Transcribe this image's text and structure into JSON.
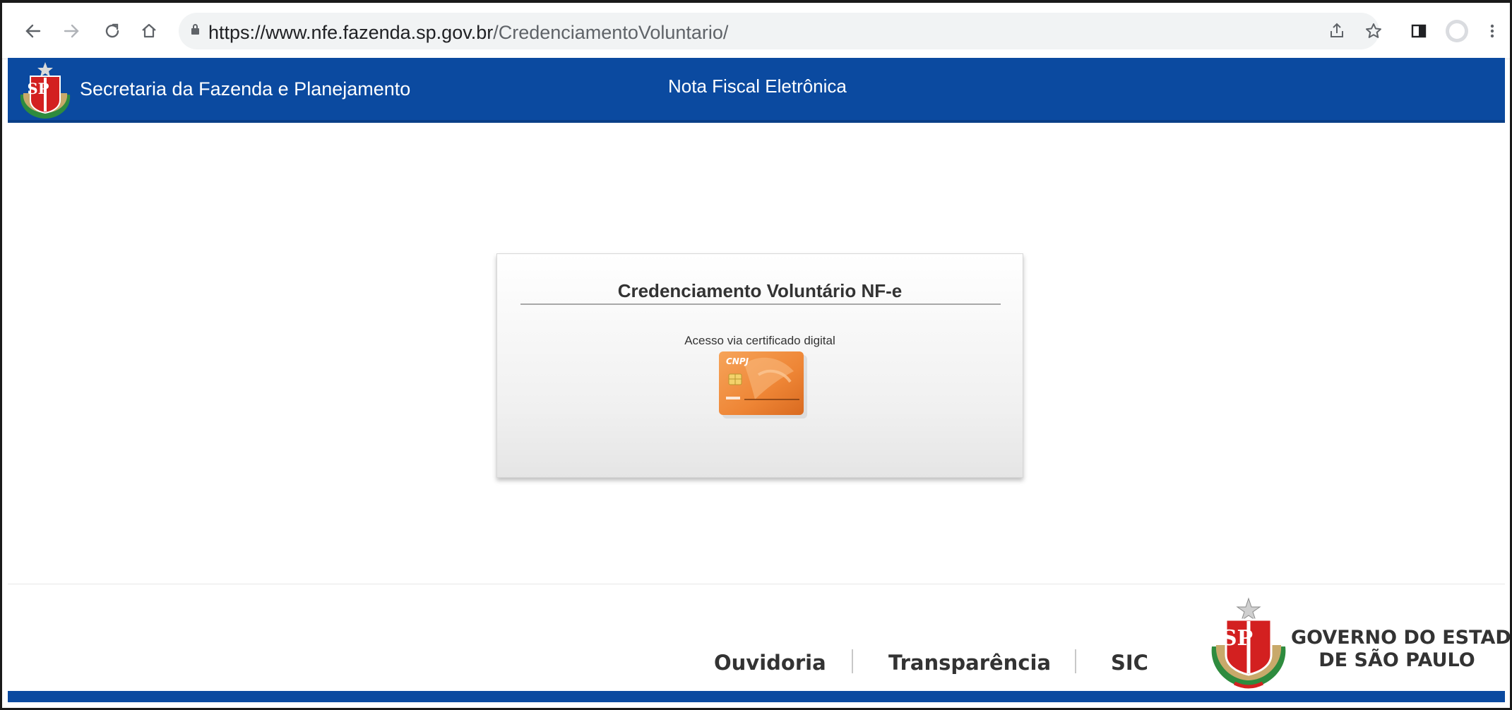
{
  "browser": {
    "url_host": "https://www.nfe.fazenda.sp.gov.br",
    "url_path": "/CredenciamentoVoluntario/",
    "icons": [
      "back-icon",
      "forward-icon",
      "reload-icon",
      "home-icon",
      "lock-icon",
      "share-icon",
      "star-icon",
      "side-panel-icon",
      "profile-icon",
      "menu-icon"
    ]
  },
  "header": {
    "agency": "Secretaria da Fazenda e Planejamento",
    "system": "Nota Fiscal Eletrônica",
    "crest_letters": "SP",
    "color": "#0b4aa0"
  },
  "login": {
    "title": "Credenciamento Voluntário NF-e",
    "subtitle": "Acesso via certificado digital",
    "card_label": "CNPJ",
    "card_color": "#f08a3c"
  },
  "footer": {
    "links": [
      "Ouvidoria",
      "Transparência",
      "SIC"
    ],
    "gov_line1": "GOVERNO DO ESTADO",
    "gov_line2": "DE SÃO PAULO",
    "crest_letters": "SP"
  }
}
